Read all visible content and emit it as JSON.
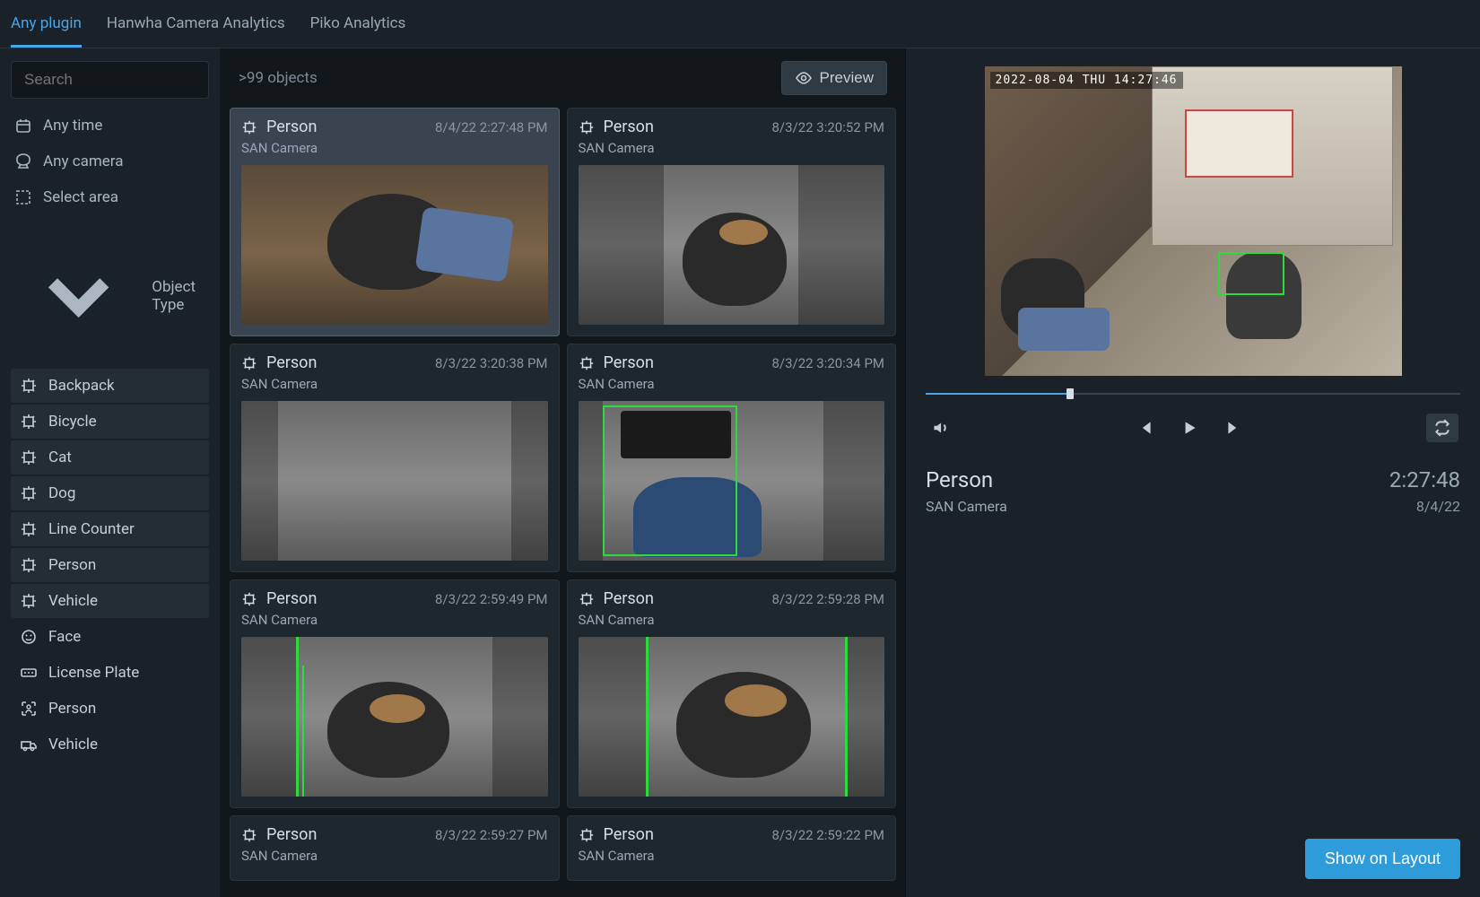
{
  "tabs": [
    "Any plugin",
    "Hanwha Camera Analytics",
    "Piko Analytics"
  ],
  "activeTab": 0,
  "search": {
    "placeholder": "Search",
    "value": ""
  },
  "filters": {
    "time": "Any time",
    "camera": "Any camera",
    "area": "Select area"
  },
  "objectTypeHeader": "Object Type",
  "objectTypes": [
    {
      "label": "Backpack",
      "icon": "chip"
    },
    {
      "label": "Bicycle",
      "icon": "chip"
    },
    {
      "label": "Cat",
      "icon": "chip"
    },
    {
      "label": "Dog",
      "icon": "chip"
    },
    {
      "label": "Line Counter",
      "icon": "chip"
    },
    {
      "label": "Person",
      "icon": "chip"
    },
    {
      "label": "Vehicle",
      "icon": "chip"
    },
    {
      "label": "Face",
      "icon": "face"
    },
    {
      "label": "License Plate",
      "icon": "plate"
    },
    {
      "label": "Person",
      "icon": "person-box"
    },
    {
      "label": "Vehicle",
      "icon": "truck"
    }
  ],
  "resultsCount": ">99 objects",
  "previewButton": "Preview",
  "results": [
    {
      "type": "Person",
      "time": "8/4/22 2:27:48 PM",
      "camera": "SAN Camera",
      "selected": true
    },
    {
      "type": "Person",
      "time": "8/3/22 3:20:52 PM",
      "camera": "SAN Camera"
    },
    {
      "type": "Person",
      "time": "8/3/22 3:20:38 PM",
      "camera": "SAN Camera"
    },
    {
      "type": "Person",
      "time": "8/3/22 3:20:34 PM",
      "camera": "SAN Camera"
    },
    {
      "type": "Person",
      "time": "8/3/22 2:59:49 PM",
      "camera": "SAN Camera"
    },
    {
      "type": "Person",
      "time": "8/3/22 2:59:28 PM",
      "camera": "SAN Camera"
    },
    {
      "type": "Person",
      "time": "8/3/22 2:59:27 PM",
      "camera": "SAN Camera"
    },
    {
      "type": "Person",
      "time": "8/3/22 2:59:22 PM",
      "camera": "SAN Camera"
    }
  ],
  "player": {
    "timestampOverlay": "2022-08-04 THU 14:27:46",
    "title": "Person",
    "camera": "SAN Camera",
    "time": "2:27:48",
    "date": "8/4/22"
  },
  "showOnLayout": "Show on Layout"
}
